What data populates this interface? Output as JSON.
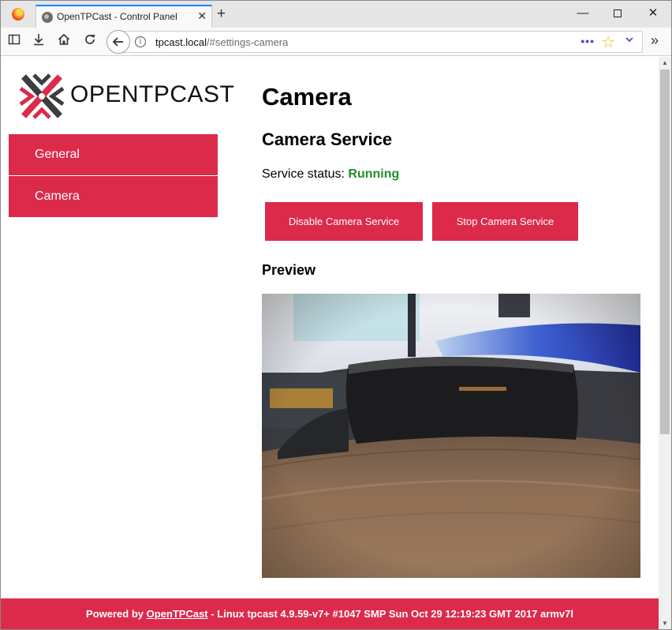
{
  "browser": {
    "tab_title": "OpenTPCast - Control Panel",
    "url_host": "tpcast.local",
    "url_path": "/#settings-camera",
    "icons": [
      "firefox-logo-icon",
      "globe-icon",
      "close-icon",
      "plus-icon",
      "minimize-icon",
      "maximize-icon",
      "sidebar-icon",
      "download-icon",
      "home-icon",
      "reload-icon",
      "back-arrow-icon",
      "info-icon",
      "page-actions-icon",
      "star-icon",
      "chevron-down-icon",
      "overflow-chevron-icon"
    ]
  },
  "logo": {
    "text": "OPENTPCAST",
    "colors": {
      "red": "#dc2a4b",
      "dark": "#3d3d3d"
    }
  },
  "sidebar": {
    "items": [
      {
        "label": "General"
      },
      {
        "label": "Camera"
      }
    ]
  },
  "main": {
    "page_title": "Camera",
    "section_title": "Camera Service",
    "status_label": "Service status:",
    "status_value": "Running",
    "buttons": {
      "disable_label": "Disable Camera Service",
      "stop_label": "Stop Camera Service"
    },
    "preview_title": "Preview"
  },
  "footer": {
    "prefix": "Powered by",
    "link_text": "OpenTPCast",
    "suffix": "- Linux tpcast 4.9.59-v7+ #1047 SMP Sun Oct 29 12:19:23 GMT 2017 armv7l"
  },
  "colors": {
    "accent": "#dc2a4b",
    "status_ok": "#1e8f2d",
    "tab_highlight": "#0a84ff"
  }
}
